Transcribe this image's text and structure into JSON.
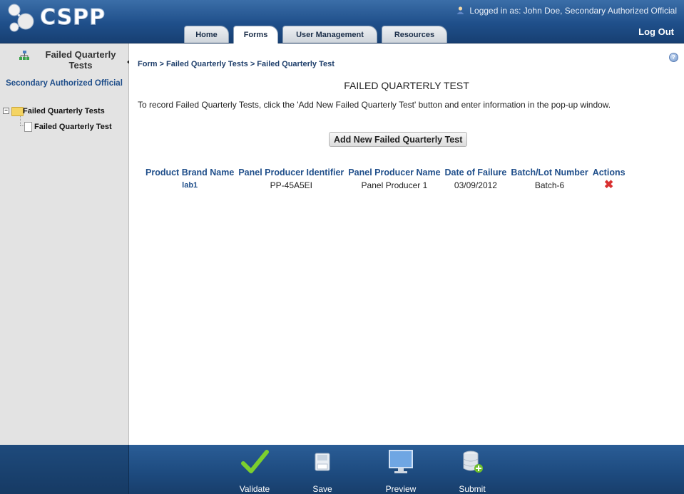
{
  "app": {
    "logo_text": "CSPP"
  },
  "header": {
    "user_prefix": "Logged in as:",
    "user_name": "John Doe, Secondary Authorized Official",
    "logout": "Log Out",
    "tabs": [
      {
        "label": "Home"
      },
      {
        "label": "Forms"
      },
      {
        "label": "User Management"
      },
      {
        "label": "Resources"
      }
    ],
    "active_tab": "Forms"
  },
  "sidebar": {
    "title": "Failed Quarterly Tests",
    "role": "Secondary Authorized Official",
    "tree": {
      "root": "Failed Quarterly Tests",
      "child": "Failed Quarterly Test"
    }
  },
  "main": {
    "breadcrumb": "Form > Failed Quarterly Tests > Failed Quarterly Test",
    "title": "FAILED QUARTERLY TEST",
    "instructions": "To record Failed Quarterly Tests, click the 'Add New Failed Quarterly Test' button and enter information in the pop-up window.",
    "add_button": "Add New Failed Quarterly Test",
    "table": {
      "headers": [
        "Product Brand Name",
        "Panel Producer Identifier",
        "Panel Producer Name",
        "Date of Failure",
        "Batch/Lot Number",
        "Actions"
      ],
      "rows": [
        {
          "brand": "lab1",
          "identifier": "PP-45A5EI",
          "producer": "Panel Producer 1",
          "date": "03/09/2012",
          "batch": "Batch-6"
        }
      ]
    }
  },
  "footer": {
    "validate": "Validate",
    "save": "Save",
    "preview": "Preview",
    "submit": "Submit"
  },
  "colors": {
    "header_blue": "#1f4f8a",
    "link_blue": "#1f4e8a",
    "delete_red": "#d83030",
    "validate_green": "#6fbf2a"
  }
}
